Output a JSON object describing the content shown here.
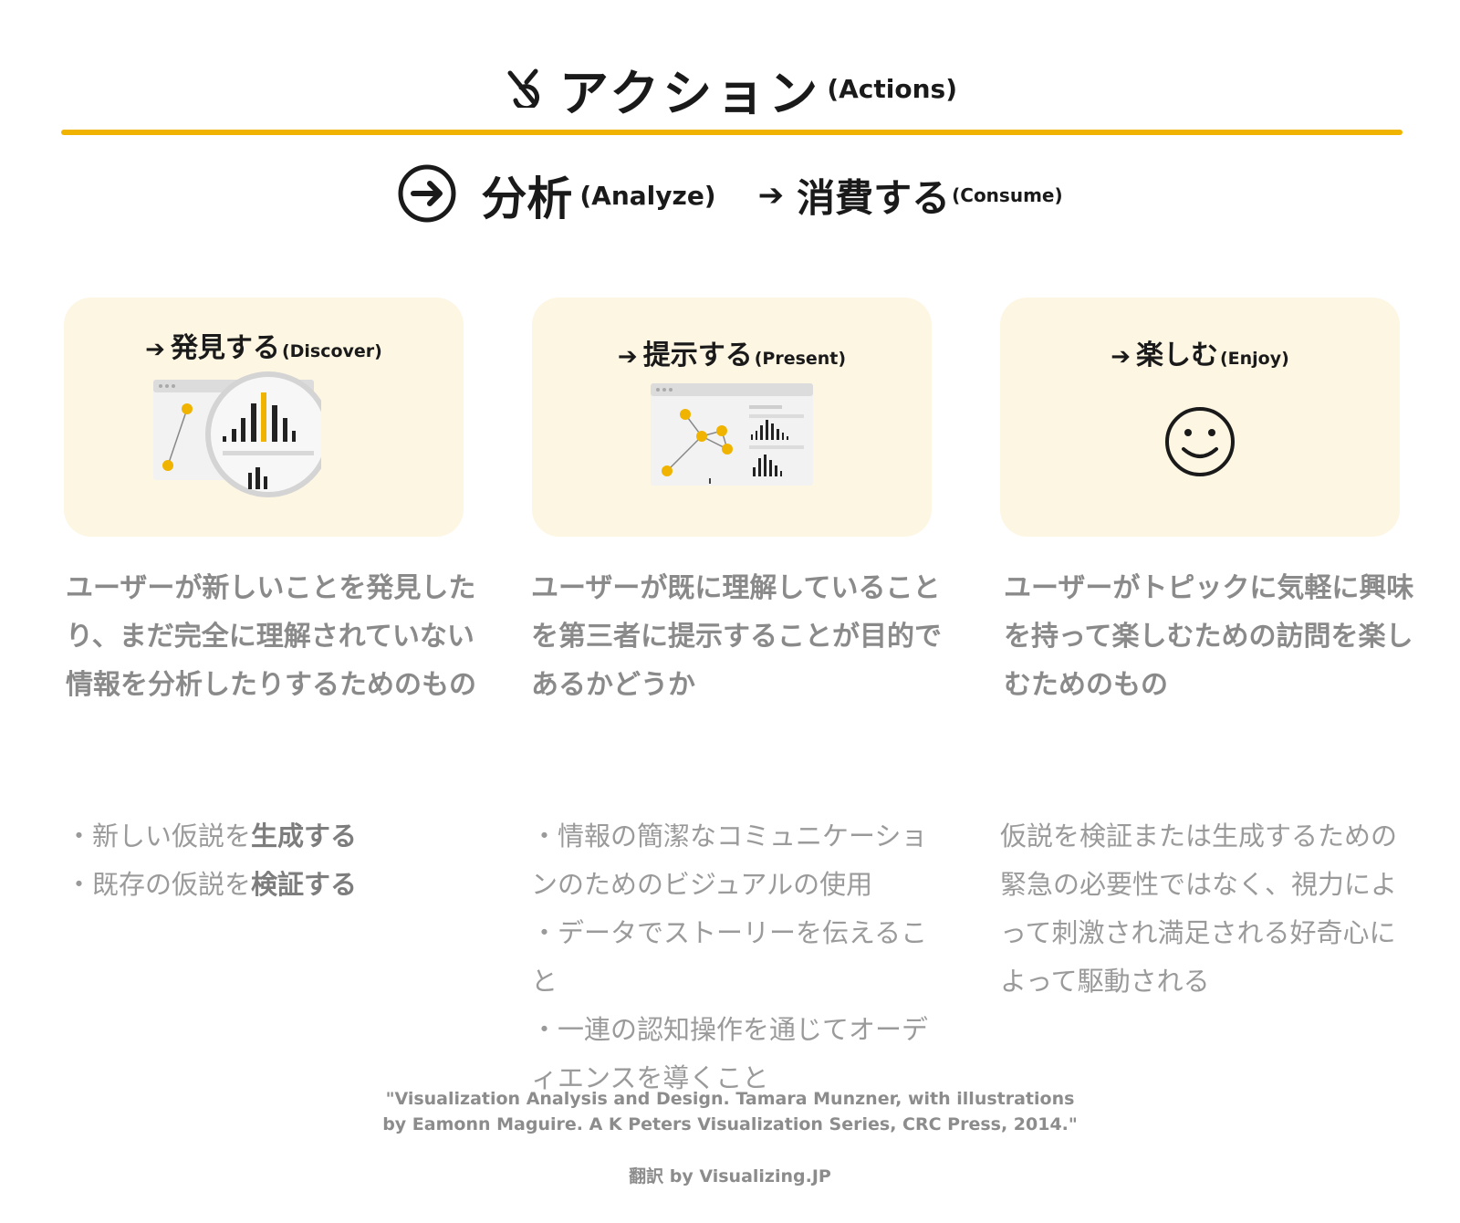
{
  "header": {
    "icon": "actions-icon",
    "title_jp": "アクション",
    "title_en": "(Actions)",
    "accent_color": "#f0b400"
  },
  "subheader": {
    "icon": "circle-arrow-right-icon",
    "analyze_jp": "分析",
    "analyze_en": "(Analyze)",
    "arrow": "➔",
    "consume_jp": "消費する",
    "consume_en": "(Consume)"
  },
  "cards": [
    {
      "arrow": "➔",
      "title_jp": "発見する",
      "title_en": "(Discover)",
      "icon": "magnifier-chart-icon",
      "lead": "ユーザーが新しいことを発見したり、まだ完全に理解されていない情報を分析したりするためのもの",
      "bullets": [
        {
          "pre": "・新しい仮説を",
          "bold": "生成する"
        },
        {
          "pre": "・既存の仮説を",
          "bold": "検証する"
        }
      ]
    },
    {
      "arrow": "➔",
      "title_jp": "提示する",
      "title_en": "(Present)",
      "icon": "presentation-window-icon",
      "lead": "ユーザーが既に理解していることを第三者に提示することが目的であるかどうか",
      "bullets": [
        "・情報の簡潔なコミュニケーションのためのビジュアルの使用",
        "・データでストーリーを伝えること",
        "・一連の認知操作を通じてオーディエンスを導くこと"
      ]
    },
    {
      "arrow": "➔",
      "title_jp": "楽しむ",
      "title_en": "(Enjoy)",
      "icon": "smiley-face-icon",
      "lead": "ユーザーがトピックに気軽に興味を持って楽しむための訪問を楽しむためのもの",
      "body": "仮説を検証または生成するための緊急の必要性ではなく、視力によって刺激され満足される好奇心によって駆動される"
    }
  ],
  "citation": {
    "line1": "\"Visualization Analysis and Design. Tamara Munzner, with illustrations",
    "line2": "by Eamonn Maguire. A K Peters Visualization Series, CRC Press, 2014.\""
  },
  "credit": "翻訳 by Visualizing.JP"
}
